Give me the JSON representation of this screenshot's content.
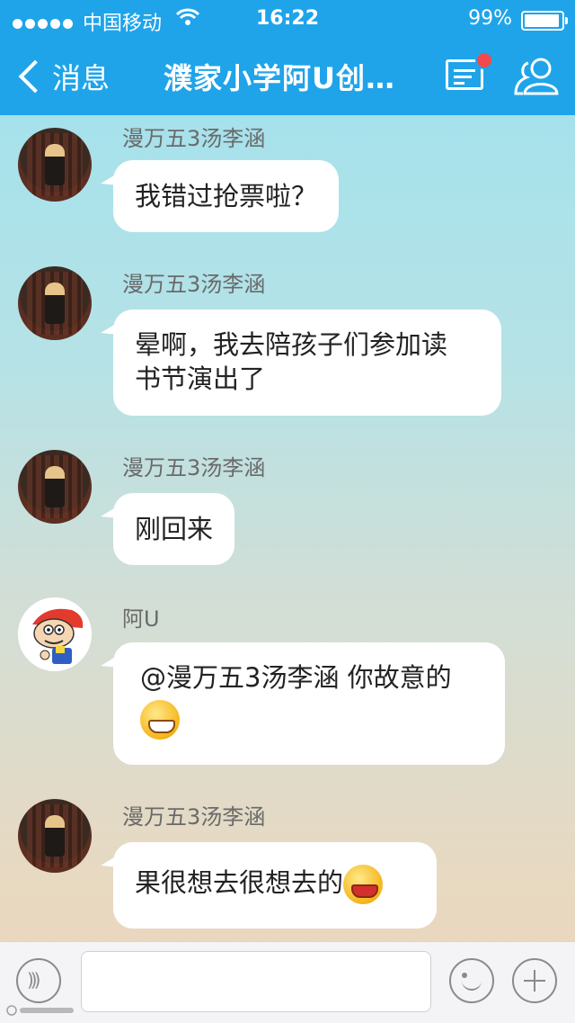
{
  "status_bar": {
    "carrier": "中国移动",
    "time": "16:22",
    "battery": "99%"
  },
  "nav": {
    "back_label": "消息",
    "title": "濮家小学阿U创…"
  },
  "messages": [
    {
      "sender": "漫万五3汤李涵",
      "lines": [
        "我错过抢票啦？"
      ]
    },
    {
      "sender": "漫万五3汤李涵",
      "lines": [
        "晕啊，我去陪孩子们参加读",
        "书节演出了"
      ]
    },
    {
      "sender": "漫万五3汤李涵",
      "lines": [
        "刚回来"
      ]
    },
    {
      "sender": "阿U",
      "lines": [
        "@漫万五3汤李涵 你故意的"
      ]
    },
    {
      "sender": "漫万五3汤李涵",
      "lines": [
        "果很想去很想去的"
      ]
    }
  ],
  "icons": {
    "back": "chevron-left-icon",
    "group_messages": "message-list-icon",
    "members": "group-members-icon",
    "voice": "voice-icon",
    "emoji": "emoji-icon",
    "more": "plus-icon"
  },
  "colors": {
    "nav_bar": "#1fa4ea",
    "notification_dot": "#f2494d",
    "bubble": "#ffffff"
  },
  "input": {
    "value": "",
    "placeholder": ""
  }
}
